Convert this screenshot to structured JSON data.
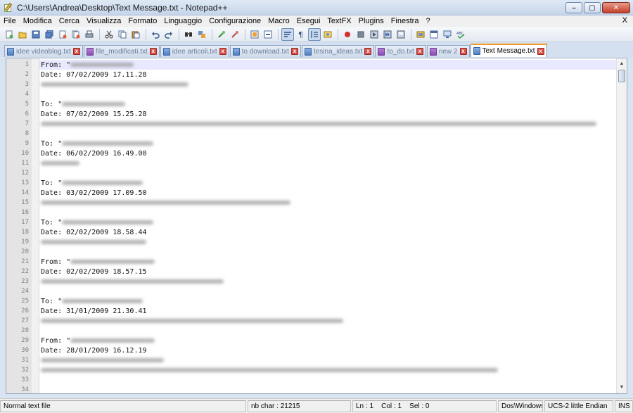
{
  "window": {
    "title": "C:\\Users\\Andrea\\Desktop\\Text Message.txt - Notepad++",
    "minimize_label": "–",
    "maximize_label": "▢",
    "close_label": "✕"
  },
  "menu": {
    "items": [
      "File",
      "Modifica",
      "Cerca",
      "Visualizza",
      "Formato",
      "Linguaggio",
      "Configurazione",
      "Macro",
      "Esegui",
      "TextFX",
      "Plugins",
      "Finestra",
      "?"
    ],
    "close_label": "X"
  },
  "toolbar": {
    "icons": [
      "new-file-icon",
      "open-file-icon",
      "save-icon",
      "save-all-icon",
      "close-icon",
      "close-all-icon",
      "print-icon",
      "cut-icon",
      "copy-icon",
      "paste-icon",
      "undo-icon",
      "redo-icon",
      "find-icon",
      "replace-icon",
      "zoom-in-icon",
      "zoom-out-icon",
      "sync-vertical-icon",
      "sync-horizontal-icon",
      "word-wrap-icon",
      "show-all-chars-icon",
      "indent-guide-icon",
      "user-lang-icon",
      "record-macro-icon",
      "stop-macro-icon",
      "play-macro-icon",
      "run-macro-multiple-icon",
      "save-macro-icon",
      "launch-browser-icon",
      "panel-icon",
      "monitor-icon",
      "spellcheck-icon"
    ]
  },
  "tabs": [
    {
      "label": "idee videoblog.txt",
      "active": false
    },
    {
      "label": "file_modificati.txt",
      "active": false
    },
    {
      "label": "idee articoli.txt",
      "active": false
    },
    {
      "label": "to download.txt",
      "active": false
    },
    {
      "label": "tesina_ideas.txt",
      "active": false
    },
    {
      "label": "to_do.txt",
      "active": false
    },
    {
      "label": "new 2",
      "active": false
    },
    {
      "label": "Text Message.txt",
      "active": true
    }
  ],
  "editor": {
    "lines": [
      {
        "n": "1",
        "text": "From: \"",
        "blur": 90
      },
      {
        "n": "2",
        "text": "Date: 07/02/2009 17.11.28",
        "blur": 0
      },
      {
        "n": "3",
        "text": "",
        "blur": 210
      },
      {
        "n": "4",
        "text": "",
        "blur": 0
      },
      {
        "n": "5",
        "text": "To: \"",
        "blur": 90
      },
      {
        "n": "6",
        "text": "Date: 07/02/2009 15.25.28",
        "blur": 0
      },
      {
        "n": "7",
        "text": "",
        "blur": 790
      },
      {
        "n": "8",
        "text": "",
        "blur": 0
      },
      {
        "n": "9",
        "text": "To: \"",
        "blur": 130
      },
      {
        "n": "10",
        "text": "Date: 06/02/2009 16.49.00",
        "blur": 0
      },
      {
        "n": "11",
        "text": "",
        "blur": 55
      },
      {
        "n": "12",
        "text": "",
        "blur": 0
      },
      {
        "n": "13",
        "text": "To: \"",
        "blur": 115
      },
      {
        "n": "14",
        "text": "Date: 03/02/2009 17.09.50",
        "blur": 0
      },
      {
        "n": "15",
        "text": "",
        "blur": 355
      },
      {
        "n": "16",
        "text": "",
        "blur": 0
      },
      {
        "n": "17",
        "text": "To: \"",
        "blur": 130
      },
      {
        "n": "18",
        "text": "Date: 02/02/2009 18.58.44",
        "blur": 0
      },
      {
        "n": "19",
        "text": "",
        "blur": 150
      },
      {
        "n": "20",
        "text": "",
        "blur": 0
      },
      {
        "n": "21",
        "text": "From: \"",
        "blur": 120
      },
      {
        "n": "22",
        "text": "Date: 02/02/2009 18.57.15",
        "blur": 0
      },
      {
        "n": "23",
        "text": "",
        "blur": 260
      },
      {
        "n": "24",
        "text": "",
        "blur": 0
      },
      {
        "n": "25",
        "text": "To: \"",
        "blur": 115
      },
      {
        "n": "26",
        "text": "Date: 31/01/2009 21.30.41",
        "blur": 0
      },
      {
        "n": "27",
        "text": "",
        "blur": 430
      },
      {
        "n": "28",
        "text": "",
        "blur": 0
      },
      {
        "n": "29",
        "text": "From: \"",
        "blur": 120
      },
      {
        "n": "30",
        "text": "Date: 28/01/2009 16.12.19",
        "blur": 0
      },
      {
        "n": "31",
        "text": "",
        "blur": 175
      },
      {
        "n": "32",
        "text": "",
        "blur": 650
      },
      {
        "n": "33",
        "text": "",
        "blur": 0
      },
      {
        "n": "34",
        "text": "",
        "blur": 0
      }
    ]
  },
  "statusbar": {
    "file_type": "Normal text file",
    "nb_char": "nb char : 21215",
    "position": "Ln : 1    Col : 1    Sel : 0",
    "eol": "Dos\\Windows",
    "encoding": "UCS-2 little Endian",
    "mode": "INS"
  }
}
